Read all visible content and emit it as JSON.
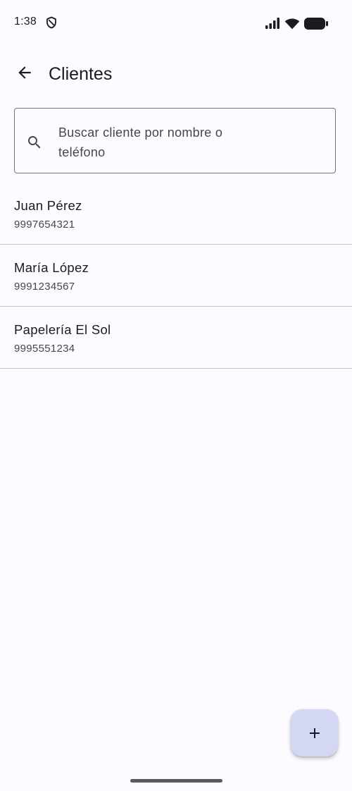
{
  "status_bar": {
    "time": "1:38",
    "icons": [
      "shield-icon",
      "signal-icon",
      "wifi-icon",
      "battery-icon"
    ]
  },
  "app_bar": {
    "title": "Clientes",
    "back_icon": "arrow-back-icon"
  },
  "search": {
    "icon": "search-icon",
    "placeholder": "Buscar cliente por nombre o teléfono",
    "value": ""
  },
  "clients": [
    {
      "name": "Juan Pérez",
      "phone": "9997654321"
    },
    {
      "name": "María López",
      "phone": "9991234567"
    },
    {
      "name": "Papelería El Sol",
      "phone": "9995551234"
    }
  ],
  "fab": {
    "icon": "add-icon",
    "background": "#d4d7f4"
  },
  "colors": {
    "background": "#fdfbff",
    "text_primary": "#1b1b1f",
    "text_secondary": "#46464f",
    "divider": "#c7c5ca",
    "outline": "#77767a"
  }
}
